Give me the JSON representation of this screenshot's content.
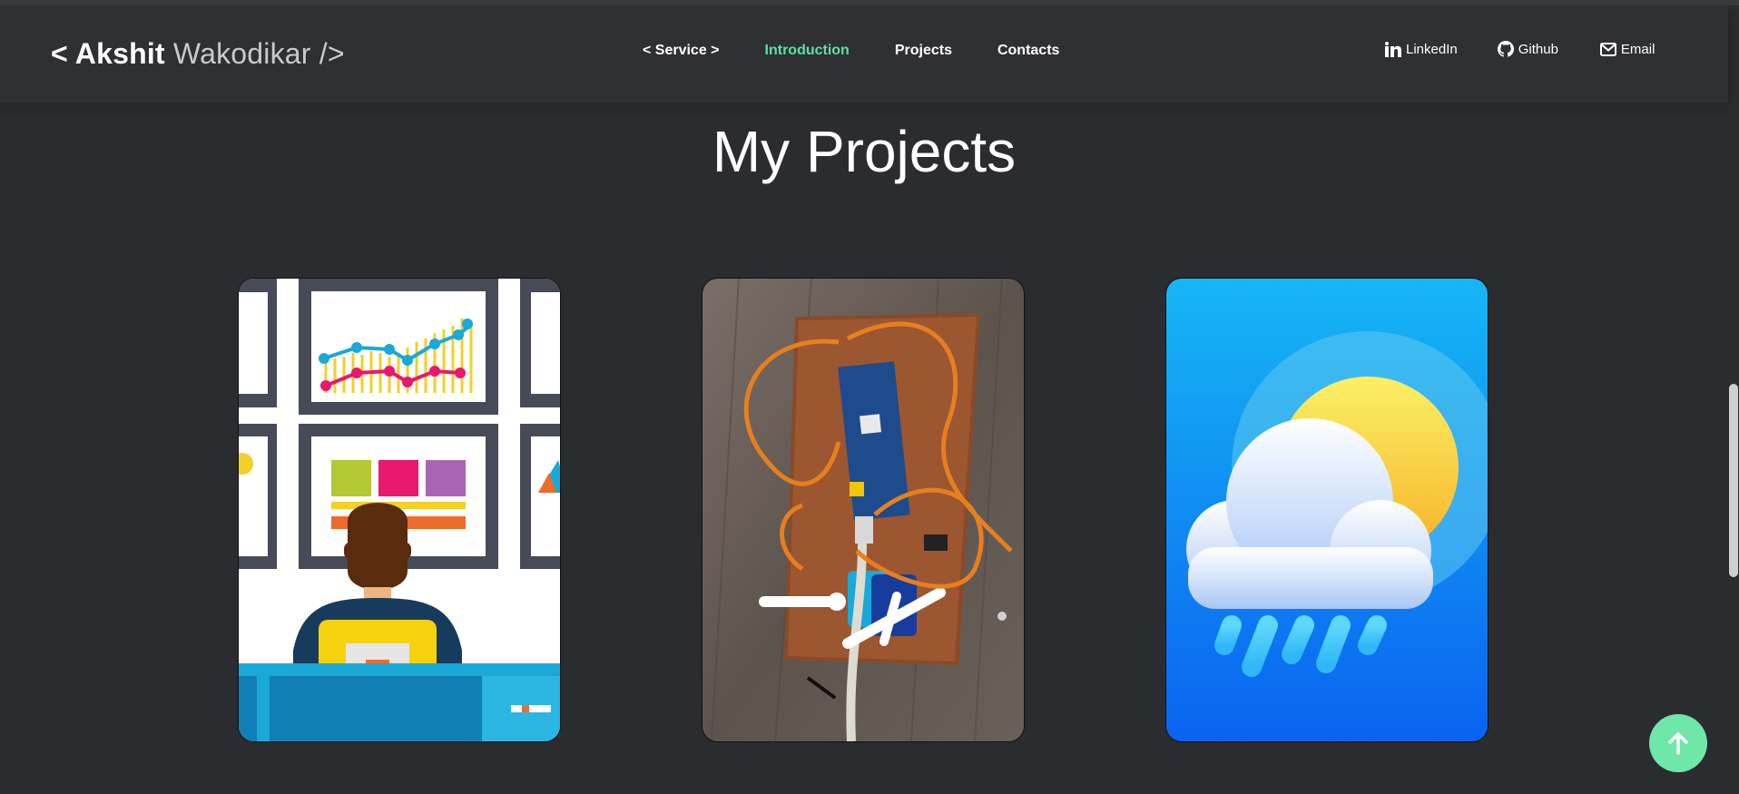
{
  "logo": {
    "first": "< Akshit",
    "last": " Wakodikar />"
  },
  "nav": {
    "items": [
      {
        "label": "< Service >",
        "active": false
      },
      {
        "label": "Introduction",
        "active": true
      },
      {
        "label": "Projects",
        "active": false
      },
      {
        "label": "Contacts",
        "active": false
      }
    ]
  },
  "social": {
    "linkedin": {
      "label": "LinkedIn",
      "icon": "linkedin-icon"
    },
    "github": {
      "label": "Github",
      "icon": "github-icon"
    },
    "email": {
      "label": "Email",
      "icon": "mail-icon"
    }
  },
  "page": {
    "title": "My Projects"
  },
  "projects": [
    {
      "image": "dashboard-analyst-illustration"
    },
    {
      "image": "microcontroller-servo-board-photo"
    },
    {
      "image": "weather-app-icon"
    }
  ],
  "colors": {
    "background": "#2b2c30",
    "navbar": "#2f3033",
    "accent": "#57e39f",
    "scroll_button": "#6ee7a8"
  },
  "scroll_top": {
    "icon": "arrow-up-icon"
  }
}
